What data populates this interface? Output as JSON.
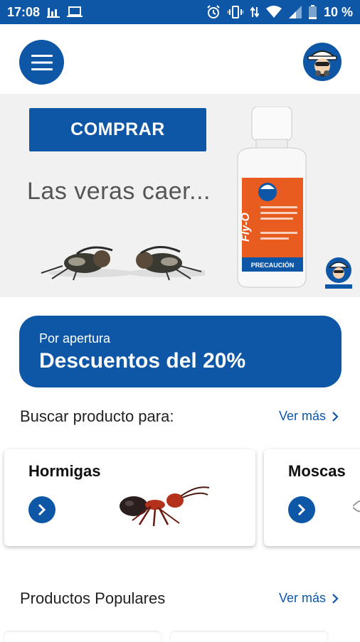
{
  "status_bar": {
    "time": "17:08",
    "battery": "10 %",
    "icons": [
      "bar-chart-icon",
      "laptop-icon",
      "alarm-icon",
      "vibrate-icon",
      "data-arrows-icon",
      "wifi-icon",
      "signal-icon",
      "battery-icon"
    ]
  },
  "app_bar": {
    "menu_icon": "hamburger-menu-icon",
    "logo": "exterminator-logo"
  },
  "banner": {
    "buy_label": "COMPRAR",
    "tagline": "Las veras caer...",
    "product_name": "Fly-O",
    "product_warning": "PRECAUCIÓN"
  },
  "promo": {
    "small_text": "Por apertura",
    "big_text": "Descuentos del 20%"
  },
  "search_section": {
    "title": "Buscar producto para:",
    "see_more": "Ver más",
    "categories": [
      {
        "label": "Hormigas"
      },
      {
        "label": "Moscas"
      }
    ]
  },
  "popular_section": {
    "title": "Productos Populares",
    "see_more": "Ver más"
  },
  "colors": {
    "primary": "#0d57a6",
    "banner_bg": "#f1f1f1",
    "bottle_orange": "#e85d1f"
  }
}
